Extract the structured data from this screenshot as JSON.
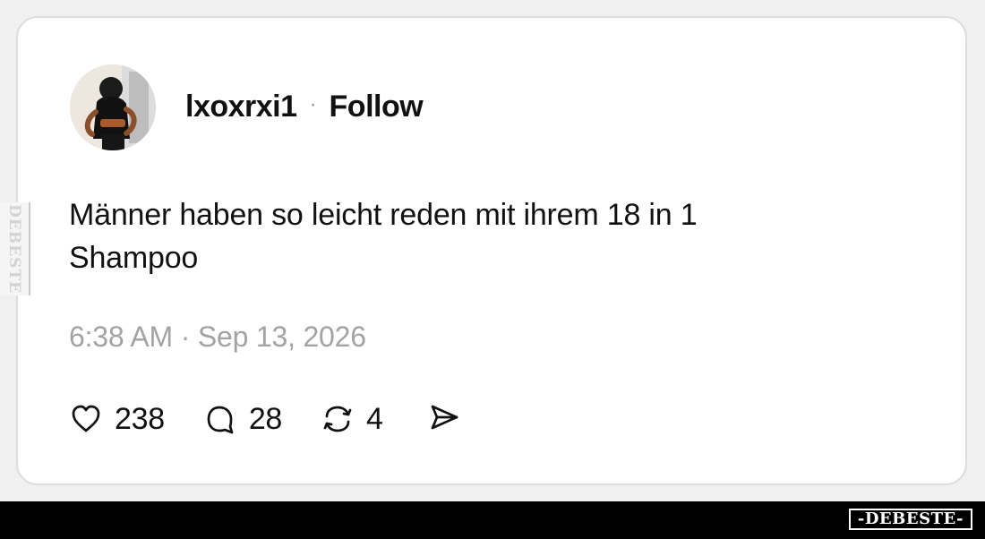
{
  "post": {
    "username": "lxoxrxi1",
    "separator": "·",
    "follow_label": "Follow",
    "text": "Männer haben so leicht reden mit ihrem 18 in 1\nShampoo",
    "timestamp": "6:38 AM · Sep 13, 2026",
    "actions": {
      "likes": "238",
      "comments": "28",
      "reposts": "4"
    }
  },
  "watermarks": {
    "side": "DEBESTE",
    "footer": "-DEBESTE-"
  },
  "colors": {
    "card_background": "#ffffff",
    "page_background": "#f0f0f0",
    "text": "#111111",
    "muted_text": "#a3a3a3",
    "footer_background": "#000000"
  },
  "icons": {
    "avatar": "profile-avatar",
    "like": "heart-icon",
    "comment": "speech-bubble-icon",
    "repost": "repost-icon",
    "share": "send-icon"
  }
}
